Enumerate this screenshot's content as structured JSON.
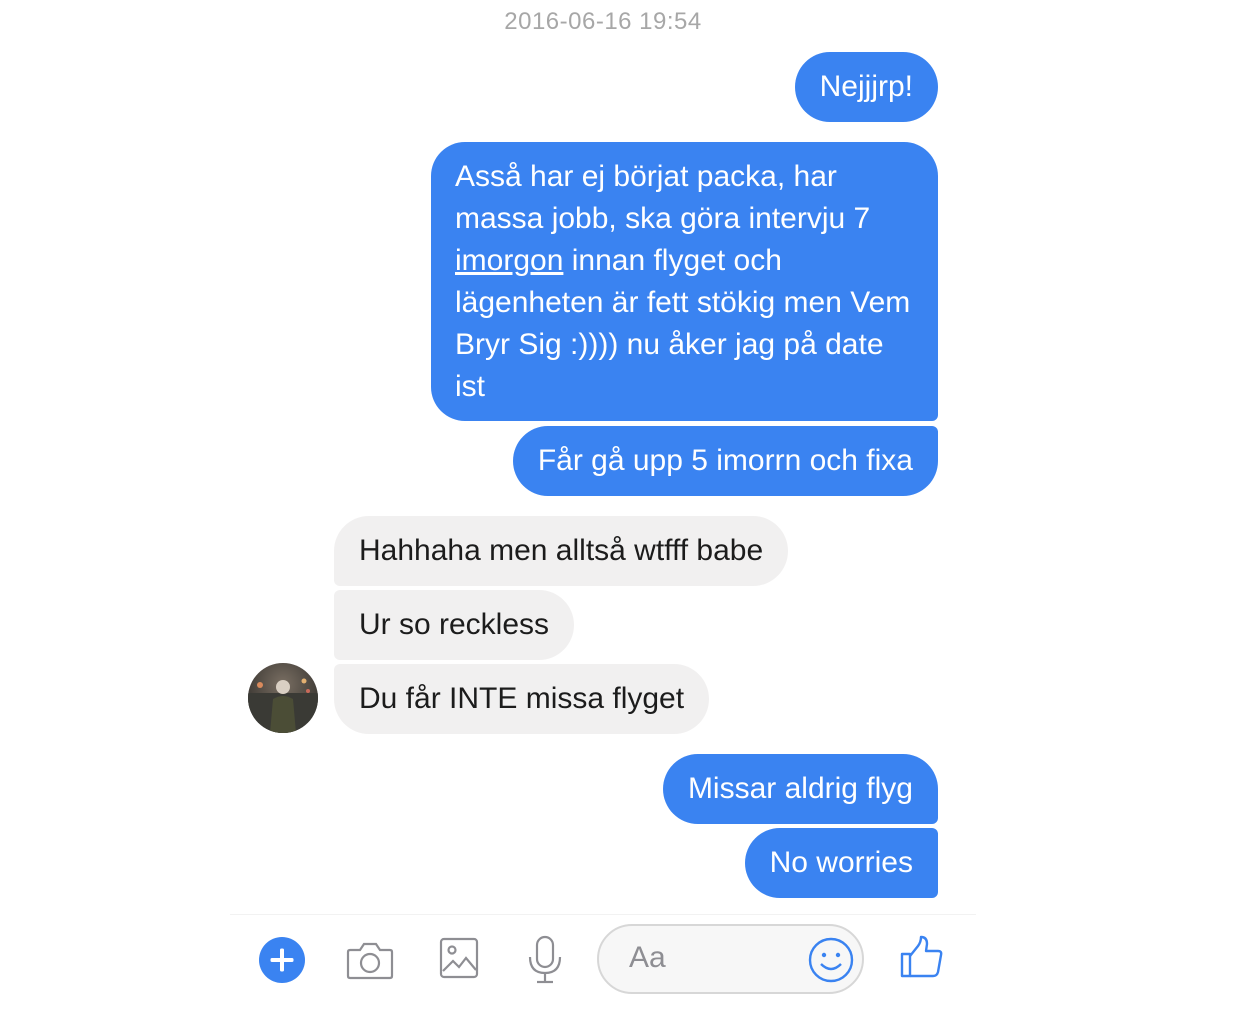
{
  "thread": {
    "timestamp": "2016-06-16 19:54"
  },
  "messages": [
    {
      "sender": "me",
      "text": "Nejjjrp!"
    },
    {
      "sender": "me",
      "text_parts": [
        "Asså har ej börjat packa, har massa jobb, ska göra intervju 7 ",
        "imorgon",
        " innan flyget och lägenheten är fett stökig men Vem Bryr Sig :)))) nu åker jag på date ist"
      ]
    },
    {
      "sender": "me",
      "text": "Får gå upp 5 imorrn och fixa"
    },
    {
      "sender": "them",
      "text": "Hahhaha men alltså wtfff babe"
    },
    {
      "sender": "them",
      "text": "Ur so reckless"
    },
    {
      "sender": "them",
      "text": "Du får INTE missa flyget"
    },
    {
      "sender": "me",
      "text": "Missar aldrig flyg"
    },
    {
      "sender": "me",
      "text": "No worries"
    }
  ],
  "composer": {
    "placeholder": "Aa",
    "icons": [
      "plus-icon",
      "camera-icon",
      "image-icon",
      "microphone-icon",
      "emoji-icon",
      "thumbs-up-icon"
    ]
  },
  "colors": {
    "outgoing_bubble": "#3a83f1",
    "incoming_bubble": "#f1f0f0",
    "accent": "#3a83f1"
  }
}
